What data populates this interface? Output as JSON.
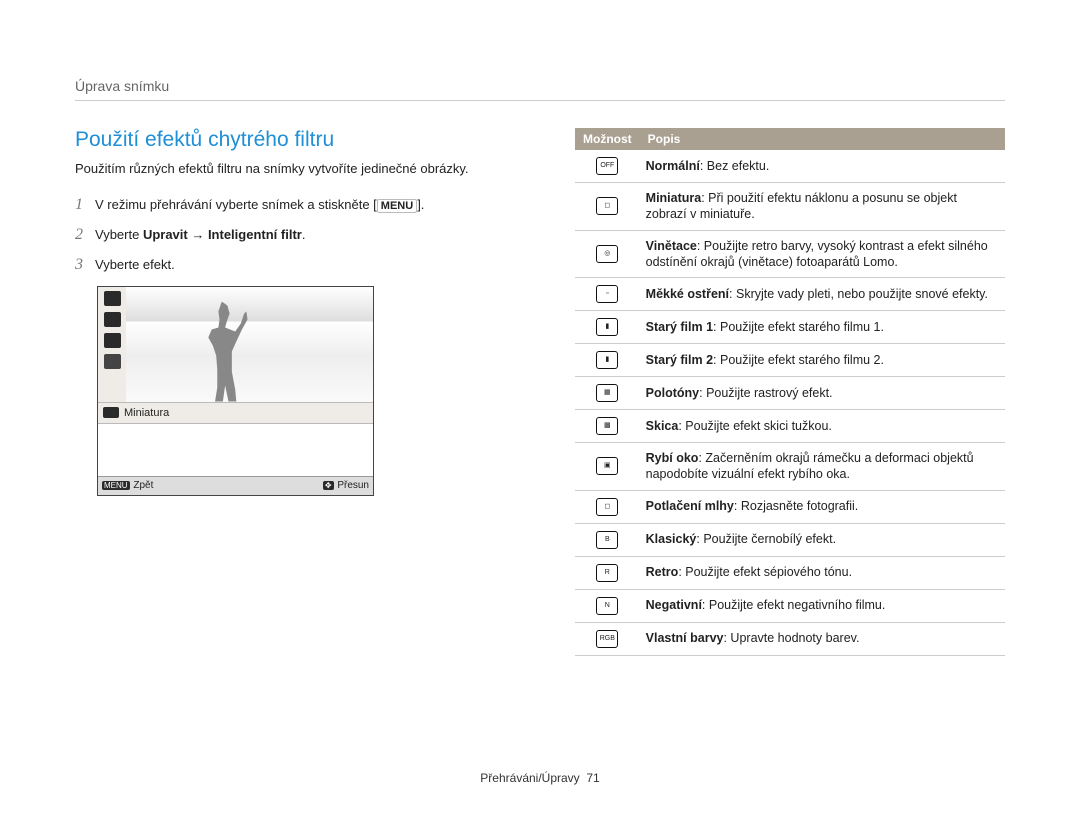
{
  "breadcrumb": "Úprava snímku",
  "section_title": "Použití efektů chytrého filtru",
  "intro": "Použitím různých efektů filtru na snímky vytvoříte jedinečné obrázky.",
  "steps": {
    "n1": "1",
    "t1_a": "V režimu přehrávání vyberte snímek a stiskněte [",
    "t1_menu": "MENU",
    "t1_b": "].",
    "n2": "2",
    "t2_a": "Vyberte ",
    "t2_b": "Upravit → Inteligentní filtr",
    "t2_c": ".",
    "n3": "3",
    "t3": "Vyberte efekt."
  },
  "lcd": {
    "label": "Miniatura",
    "back_key": "MENU",
    "back_text": "Zpět",
    "move_key": "✥",
    "move_text": "Přesun"
  },
  "table": {
    "h1": "Možnost",
    "h2": "Popis",
    "rows": [
      {
        "icon": "OFF",
        "name": "Normální",
        "desc": ": Bez efektu."
      },
      {
        "icon": "◻",
        "name": "Miniatura",
        "desc": ": Při použití efektu náklonu a posunu se objekt zobrazí v miniatuře."
      },
      {
        "icon": "◎",
        "name": "Vinětace",
        "desc": ": Použijte retro barvy, vysoký kontrast a efekt silného odstínění okrajů (vinětace) fotoaparátů Lomo."
      },
      {
        "icon": "▫",
        "name": "Měkké ostření",
        "desc": ": Skryjte vady pleti, nebo použijte snové efekty."
      },
      {
        "icon": "▮",
        "name": "Starý film 1",
        "desc": ": Použijte efekt starého filmu 1."
      },
      {
        "icon": "▮",
        "name": "Starý film 2",
        "desc": ": Použijte efekt starého filmu 2."
      },
      {
        "icon": "▦",
        "name": "Polotóny",
        "desc": ": Použijte rastrový efekt."
      },
      {
        "icon": "▩",
        "name": "Skica",
        "desc": ": Použijte efekt skici tužkou."
      },
      {
        "icon": "▣",
        "name": "Rybí oko",
        "desc": ": Začerněním okrajů rámečku a deformaci objektů napodobíte vizuální efekt rybího oka."
      },
      {
        "icon": "◻",
        "name": "Potlačení mlhy",
        "desc": ": Rozjasněte fotografii."
      },
      {
        "icon": "B",
        "name": "Klasický",
        "desc": ": Použijte černobílý efekt."
      },
      {
        "icon": "R",
        "name": "Retro",
        "desc": ": Použijte efekt sépiového tónu."
      },
      {
        "icon": "N",
        "name": "Negativní",
        "desc": ": Použijte efekt negativního filmu."
      },
      {
        "icon": "RGB",
        "name": "Vlastní barvy",
        "desc": ": Upravte hodnoty barev."
      }
    ]
  },
  "footer": {
    "label": "Přehráváni/Úpravy",
    "page": "71"
  }
}
